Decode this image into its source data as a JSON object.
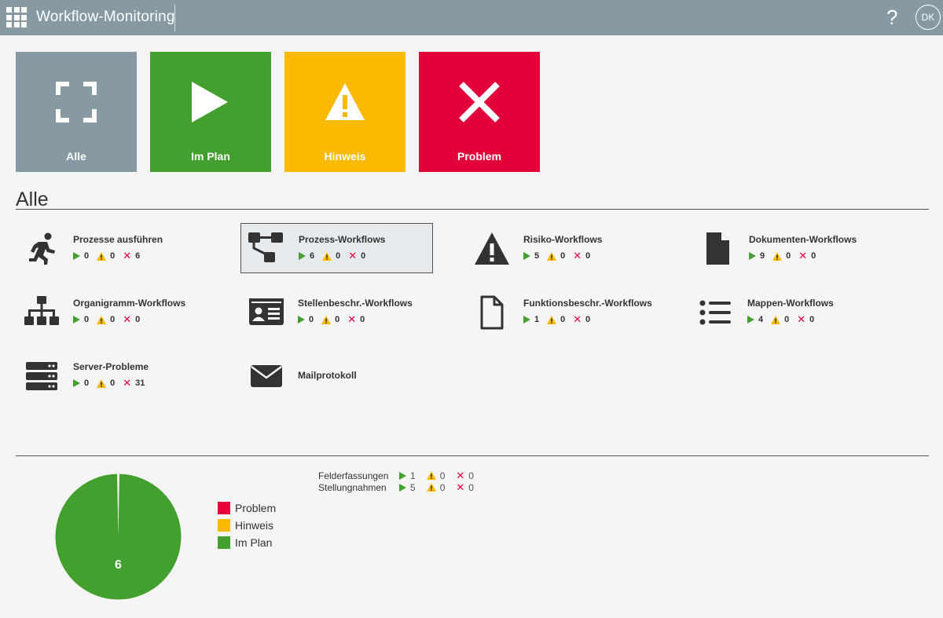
{
  "header": {
    "title": "Workflow-Monitoring",
    "help": "?",
    "user_initials": "DK"
  },
  "tiles": [
    {
      "label": "Alle",
      "color": "#879aa3",
      "icon": "fullscreen-corners-icon"
    },
    {
      "label": "Im Plan",
      "color": "#44a02e",
      "icon": "play-icon"
    },
    {
      "label": "Hinweis",
      "color": "#fbba00",
      "icon": "warning-icon"
    },
    {
      "label": "Problem",
      "color": "#e3003a",
      "icon": "close-x-icon"
    }
  ],
  "section": {
    "title": "Alle"
  },
  "workflows": [
    {
      "name": "Prozesse ausführen",
      "icon": "running-person-icon",
      "ok": "0",
      "warn": "0",
      "err": "6",
      "active": false
    },
    {
      "name": "Prozess-Workflows",
      "icon": "process-flow-icon",
      "ok": "6",
      "warn": "0",
      "err": "0",
      "active": true
    },
    {
      "name": "Risiko-Workflows",
      "icon": "warning-triangle-icon",
      "ok": "5",
      "warn": "0",
      "err": "0",
      "active": false
    },
    {
      "name": "Dokumenten-Workflows",
      "icon": "document-icon",
      "ok": "9",
      "warn": "0",
      "err": "0",
      "active": false
    },
    {
      "name": "Organigramm-Workflows",
      "icon": "org-chart-icon",
      "ok": "0",
      "warn": "0",
      "err": "0",
      "active": false
    },
    {
      "name": "Stellenbeschr.-Workflows",
      "icon": "id-card-icon",
      "ok": "0",
      "warn": "0",
      "err": "0",
      "active": false
    },
    {
      "name": "Funktionsbeschr.-Workflows",
      "icon": "document-outline-icon",
      "ok": "1",
      "warn": "0",
      "err": "0",
      "active": false
    },
    {
      "name": "Mappen-Workflows",
      "icon": "list-icon",
      "ok": "4",
      "warn": "0",
      "err": "0",
      "active": false
    },
    {
      "name": "Server-Probleme",
      "icon": "server-icon",
      "ok": "0",
      "warn": "0",
      "err": "31",
      "active": false
    },
    {
      "name": "Mailprotokoll",
      "icon": "envelope-icon"
    }
  ],
  "summary": [
    {
      "name": "Felderfassungen",
      "ok": "1",
      "warn": "0",
      "err": "0"
    },
    {
      "name": "Stellungnahmen",
      "ok": "5",
      "warn": "0",
      "err": "0"
    }
  ],
  "chart_data": {
    "type": "pie",
    "categories": [
      "Problem",
      "Hinweis",
      "Im Plan"
    ],
    "values": [
      0,
      0,
      6
    ],
    "colors": [
      "#e3003a",
      "#fbba00",
      "#44a02e"
    ],
    "center_label": "6",
    "legend_position": "right"
  },
  "colors": {
    "header": "#879aa3",
    "ok": "#44a02e",
    "warn": "#fbba00",
    "err": "#e3003a"
  }
}
